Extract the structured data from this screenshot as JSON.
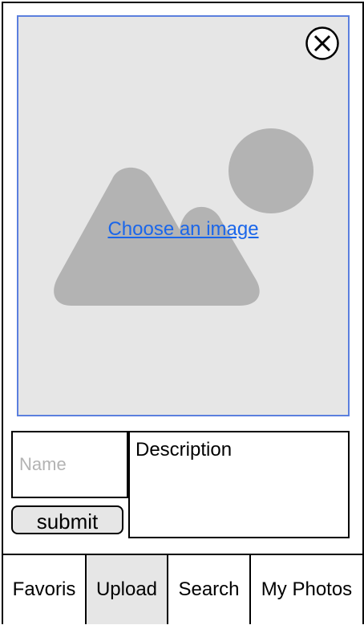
{
  "upload": {
    "choose_link": "Choose an image",
    "close_icon": "close-x-circle-icon",
    "placeholder_icon": "image-placeholder-icon"
  },
  "form": {
    "name_placeholder": "Name",
    "description_placeholder": "Description",
    "submit_label": "submit"
  },
  "tabs": [
    {
      "label": "Favoris",
      "active": false
    },
    {
      "label": "Upload",
      "active": true
    },
    {
      "label": "Search",
      "active": false
    },
    {
      "label": "My Photos",
      "active": false
    }
  ],
  "colors": {
    "dropzone_bg": "#e6e6e6",
    "dropzone_border": "#5b7fde",
    "placeholder_shape": "#b3b3b3",
    "link": "#1a66ea",
    "active_tab_bg": "#e6e6e6"
  }
}
